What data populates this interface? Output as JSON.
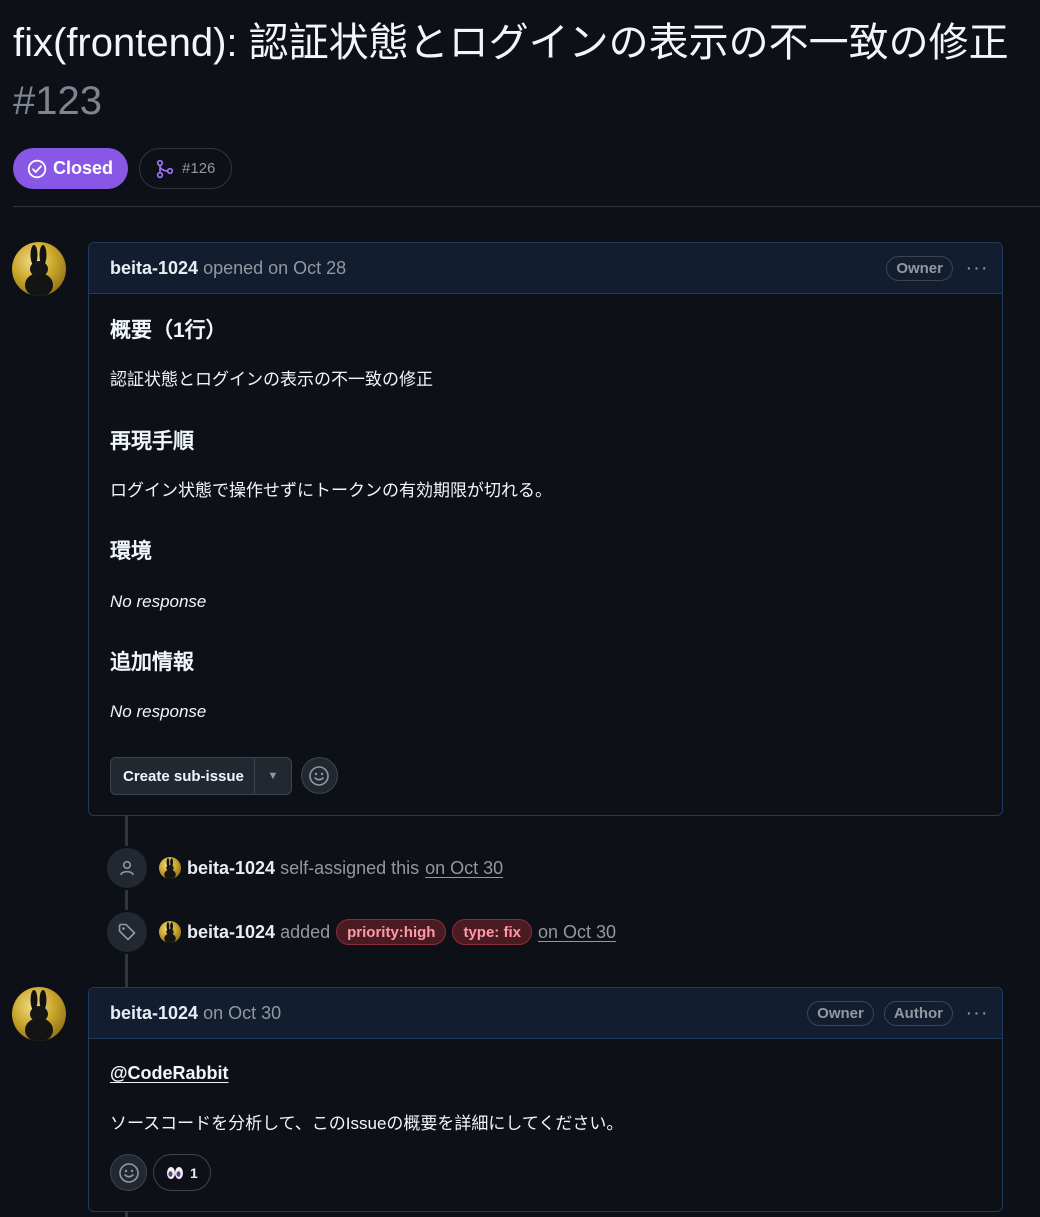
{
  "issue": {
    "title": "fix(frontend): 認証状態とログインの表示の不一致の修正",
    "number": "#123",
    "state": "Closed",
    "linked_pr": "#126"
  },
  "colors": {
    "closed_accent": "#8957e5",
    "label_bg": "#4a1b22",
    "label_text": "#ff9aa6"
  },
  "first_comment": {
    "author": "beita-1024",
    "meta": "opened on Oct 28",
    "badges": [
      "Owner"
    ],
    "sections": [
      {
        "heading": "概要（1行）",
        "body": "認証状態とログインの表示の不一致の修正",
        "italic": false
      },
      {
        "heading": "再現手順",
        "body": "ログイン状態で操作せずにトークンの有効期限が切れる。",
        "italic": false
      },
      {
        "heading": "環境",
        "body": "No response",
        "italic": true
      },
      {
        "heading": "追加情報",
        "body": "No response",
        "italic": true
      }
    ],
    "create_sub_issue_label": "Create sub-issue"
  },
  "events": [
    {
      "icon": "person-icon",
      "actor": "beita-1024",
      "action": "self-assigned this",
      "labels": [],
      "when": "on Oct 30"
    },
    {
      "icon": "tag-icon",
      "actor": "beita-1024",
      "action": "added",
      "labels": [
        "priority:high",
        "type: fix"
      ],
      "when": "on Oct 30"
    }
  ],
  "second_comment": {
    "author": "beita-1024",
    "meta": "on Oct 30",
    "badges": [
      "Owner",
      "Author"
    ],
    "mention": "@CodeRabbit",
    "body": "ソースコードを分析して、このIssueの概要を詳細にしてください。",
    "reaction": {
      "icon": "eyes-icon",
      "count": "1"
    }
  }
}
